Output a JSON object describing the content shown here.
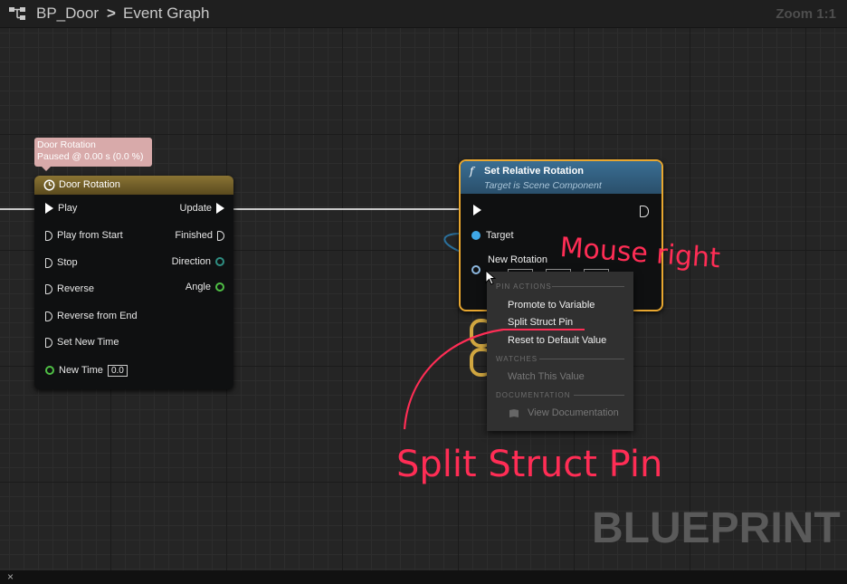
{
  "breadcrumb": {
    "asset": "BP_Door",
    "separator": ">",
    "graph": "Event Graph"
  },
  "zoom_label": "Zoom 1:1",
  "comment": {
    "line1": "Door Rotation",
    "line2": "Paused @ 0.00 s (0.0 %)"
  },
  "timeline_node": {
    "title": "Door Rotation",
    "inputs": [
      "Play",
      "Play from Start",
      "Stop",
      "Reverse",
      "Reverse from End",
      "Set New Time"
    ],
    "new_time_label": "New Time",
    "new_time_value": "0.0",
    "outputs": [
      "Update",
      "Finished",
      "Direction",
      "Angle"
    ]
  },
  "set_node": {
    "title": "Set Relative Rotation",
    "subtitle": "Target is Scene Component",
    "function_glyph": "f",
    "target_label": "Target",
    "new_rotation_label": "New Rotation"
  },
  "context_menu": {
    "section_pin_actions": "PIN ACTIONS",
    "promote": "Promote to Variable",
    "split": "Split Struct Pin",
    "reset": "Reset to Default Value",
    "section_watches": "WATCHES",
    "watch": "Watch This Value",
    "section_documentation": "DOCUMENTATION",
    "view_doc": "View Documentation"
  },
  "annotations": {
    "mouse_right": "Mouse right",
    "split_struct_pin": "Split Struct Pin"
  },
  "watermark": "BLUEPRINT",
  "bottom_close": "×",
  "colors": {
    "exec_wire": "#ffffff",
    "annotation": "#ff2d55",
    "node_highlight": "#e8a730",
    "timeline_header": "#8a7434",
    "function_header": "#3a6e93"
  }
}
